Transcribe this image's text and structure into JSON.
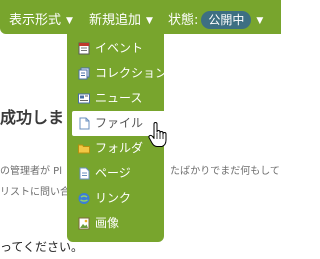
{
  "toolbar": {
    "display_label": "表示形式",
    "add_label": "新規追加",
    "state_label": "状態:",
    "state_badge": "公開中"
  },
  "page": {
    "heading": "成功しました",
    "text1": "の管理者が Pl",
    "text1_right": "たばかりでまだ何もして",
    "text2": "リストに問い合",
    "text3": "ってください。"
  },
  "menu": {
    "items": [
      {
        "label": "イベント",
        "icon": "event-icon"
      },
      {
        "label": "コレクション",
        "icon": "collection-icon"
      },
      {
        "label": "ニュース",
        "icon": "news-icon"
      },
      {
        "label": "ファイル",
        "icon": "file-icon"
      },
      {
        "label": "フォルダ",
        "icon": "folder-icon"
      },
      {
        "label": "ページ",
        "icon": "page-icon"
      },
      {
        "label": "リンク",
        "icon": "link-icon"
      },
      {
        "label": "画像",
        "icon": "image-icon"
      }
    ]
  },
  "colors": {
    "toolbar_bg": "#78a52d",
    "badge_bg": "#3d6f82"
  }
}
